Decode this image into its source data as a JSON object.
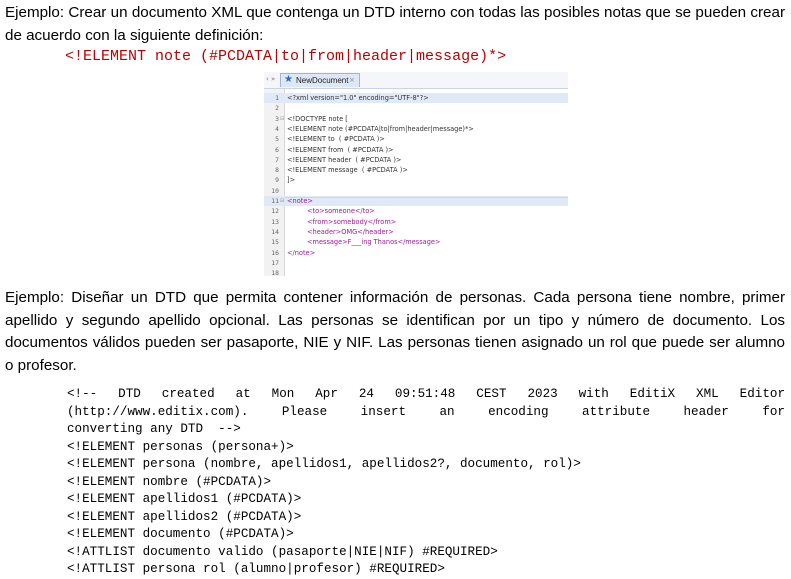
{
  "paragraph1": "Ejemplo: Crear un documento XML que contenga un DTD interno con todas las posibles notas que se pueden crear de acuerdo con la siguiente definición:",
  "dtd_definition": "<!ELEMENT note (#PCDATA|to|from|header|message)*>",
  "editor": {
    "tab_label": "NewDocument",
    "lines": [
      {
        "num": "1",
        "text": "<?xml version=\"1.0\" encoding=\"UTF-8\"?>"
      },
      {
        "num": "2",
        "text": ""
      },
      {
        "num": "3",
        "text": "<!DOCTYPE note ["
      },
      {
        "num": "4",
        "text": "<!ELEMENT note (#PCDATA|to|from|header|message)*>"
      },
      {
        "num": "5",
        "text": "<!ELEMENT to  ( #PCDATA )>"
      },
      {
        "num": "6",
        "text": "<!ELEMENT from  ( #PCDATA )>"
      },
      {
        "num": "7",
        "text": "<!ELEMENT header  ( #PCDATA )>"
      },
      {
        "num": "8",
        "text": "<!ELEMENT message  ( #PCDATA )>"
      },
      {
        "num": "9",
        "text": "]>"
      },
      {
        "num": "10",
        "text": ""
      },
      {
        "num": "11",
        "text": "<note>"
      },
      {
        "num": "12",
        "text": "<to>someone</to>"
      },
      {
        "num": "13",
        "text": "<from>somebody</from>"
      },
      {
        "num": "14",
        "text": "<header>OMG</header>"
      },
      {
        "num": "15",
        "text": "<message>F___ing Thanos</message>"
      },
      {
        "num": "16",
        "text": "</note>"
      },
      {
        "num": "17",
        "text": ""
      },
      {
        "num": "18",
        "text": ""
      }
    ]
  },
  "paragraph2": "Ejemplo: Diseñar un DTD que permita contener información de personas. Cada persona tiene nombre, primer apellido y segundo apellido opcional. Las personas se identifican por un tipo y número de documento. Los documentos válidos pueden ser pasaporte, NIE y NIF. Las personas tienen asignado un rol que puede ser alumno o profesor.",
  "code_block": {
    "comment_line1": "<!-- DTD created at Mon Apr 24 09:51:48 CEST 2023 with EditiX XML Editor",
    "comment_line2": "(http://www.editix.com). Please insert an encoding attribute header for",
    "comment_line3": "converting any DTD  -->",
    "lines": [
      "<!ELEMENT personas (persona+)>",
      "<!ELEMENT persona (nombre, apellidos1, apellidos2?, documento, rol)>",
      "<!ELEMENT nombre (#PCDATA)>",
      "<!ELEMENT apellidos1 (#PCDATA)>",
      "<!ELEMENT apellidos2 (#PCDATA)>",
      "<!ELEMENT documento (#PCDATA)>",
      "<!ATTLIST documento valido (pasaporte|NIE|NIF) #REQUIRED>",
      "<!ATTLIST persona rol (alumno|profesor) #REQUIRED>"
    ]
  },
  "colors": {
    "dtd_definition": "#c00000",
    "xml_tag": "#a0189e",
    "xml_attr": "#b8450e",
    "xml_value": "#1d3fd0",
    "editor_highlight": "#dfe9f7"
  }
}
